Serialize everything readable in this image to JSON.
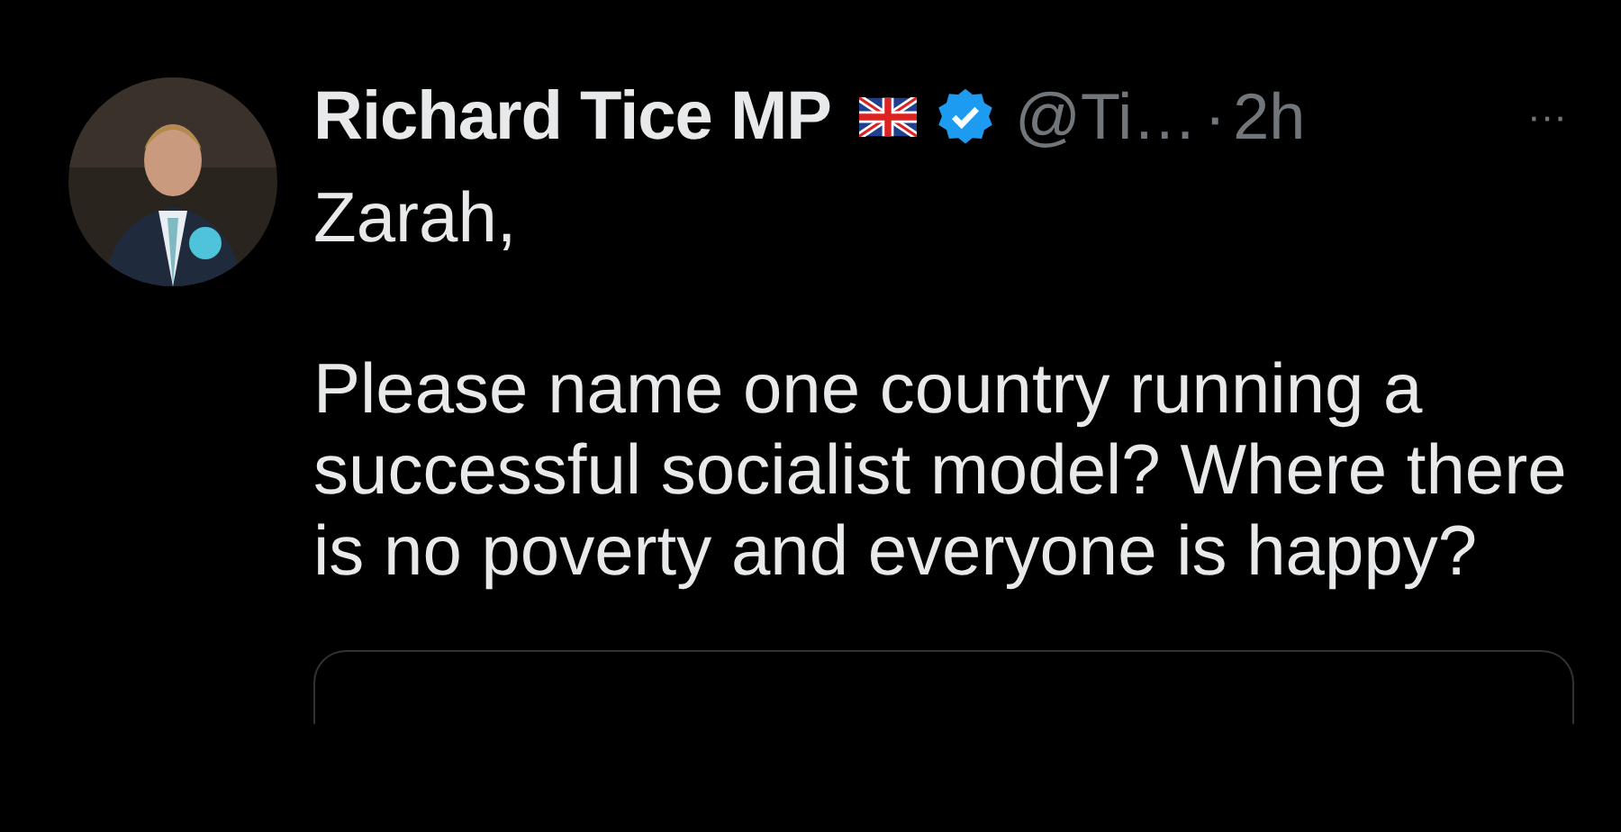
{
  "tweet": {
    "author": {
      "name": "Richard Tice MP",
      "verified": true,
      "handle": "@Ti…",
      "separator": "·",
      "time": "2h"
    },
    "menu": "···",
    "paragraphs": [
      "Zarah,",
      "Please name one country running a successful socialist model? Where there is no poverty and everyone is happy?"
    ],
    "quoted_card": {
      "kind": "card"
    }
  }
}
